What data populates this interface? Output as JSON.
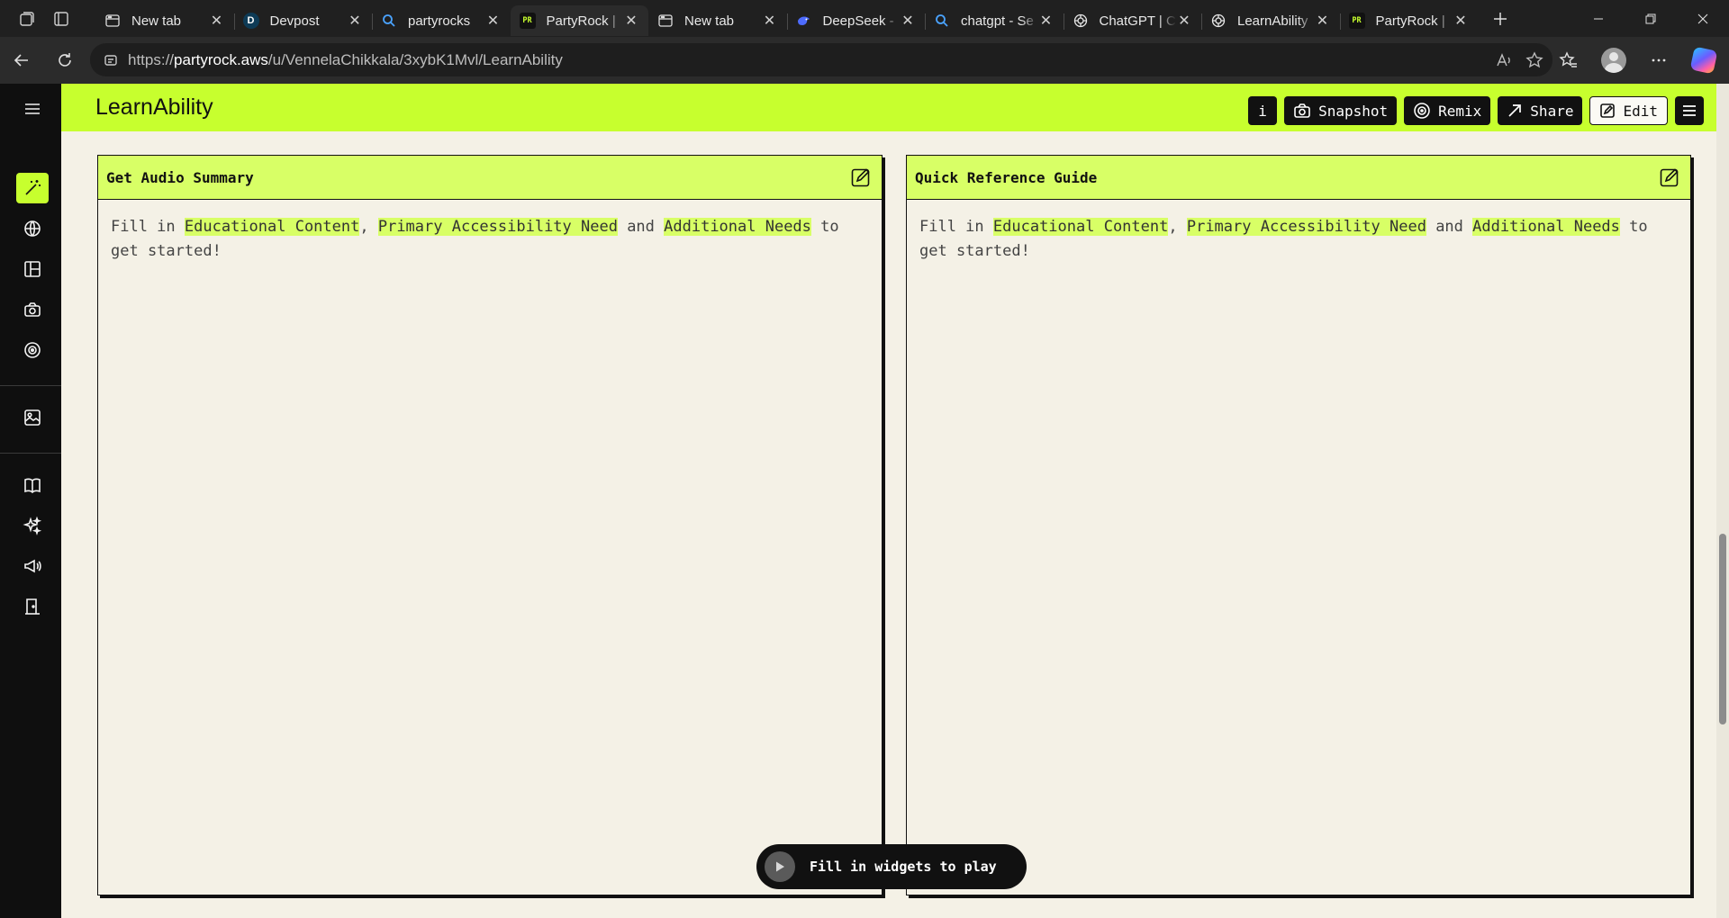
{
  "browser": {
    "tabs": [
      {
        "title": "New tab",
        "favicon": "new-tab-icon",
        "active": false
      },
      {
        "title": "Devpost",
        "favicon": "devpost-logo",
        "active": false
      },
      {
        "title": "partyrocks",
        "favicon": "search-icon",
        "active": false
      },
      {
        "title": "PartyRock |",
        "favicon": "partyrock-logo",
        "active": true
      },
      {
        "title": "New tab",
        "favicon": "new-tab-icon",
        "active": false
      },
      {
        "title": "DeepSeek -",
        "favicon": "deepseek-logo",
        "active": false
      },
      {
        "title": "chatgpt - Se",
        "favicon": "search-icon",
        "active": false
      },
      {
        "title": "ChatGPT | C",
        "favicon": "openai-logo",
        "active": false
      },
      {
        "title": "LearnAbility",
        "favicon": "openai-logo",
        "active": false
      },
      {
        "title": "PartyRock |",
        "favicon": "partyrock-logo",
        "active": false
      }
    ],
    "favicon_text": {
      "partyrock": "PR",
      "devpost": "D"
    },
    "url_scheme": "https://",
    "url_host": "partyrock.aws",
    "url_path": "/u/VennelaChikkala/3xybK1Mvl/LearnAbility"
  },
  "app": {
    "title": "LearnAbility",
    "accent_color": "#c7ff2e",
    "buttons": {
      "info": "i",
      "snapshot": "Snapshot",
      "remix": "Remix",
      "share": "Share",
      "edit": "Edit"
    }
  },
  "sidebar": {
    "items": [
      {
        "icon": "magic-wand-icon",
        "active": true
      },
      {
        "icon": "globe-icon",
        "active": false
      },
      {
        "icon": "layout-icon",
        "active": false
      },
      {
        "icon": "camera-icon",
        "active": false
      },
      {
        "icon": "remix-icon",
        "active": false
      },
      {
        "icon": "image-gallery-icon",
        "active": false
      },
      {
        "icon": "book-icon",
        "active": false
      },
      {
        "icon": "sparkles-icon",
        "active": false
      },
      {
        "icon": "megaphone-icon",
        "active": false
      },
      {
        "icon": "exit-door-icon",
        "active": false
      }
    ]
  },
  "widgets": [
    {
      "title": "Get Audio Summary",
      "body": {
        "prefix": "Fill in ",
        "field1": "Educational Content",
        "sep1": ", ",
        "field2": "Primary Accessibility Need",
        "sep2": " and ",
        "field3": "Additional Needs",
        "suffix": " to get started!"
      }
    },
    {
      "title": "Quick Reference Guide",
      "body": {
        "prefix": "Fill in ",
        "field1": "Educational Content",
        "sep1": ", ",
        "field2": "Primary Accessibility Need",
        "sep2": " and ",
        "field3": "Additional Needs",
        "suffix": " to get started!"
      }
    }
  ],
  "player": {
    "label": "Fill in widgets to play"
  }
}
